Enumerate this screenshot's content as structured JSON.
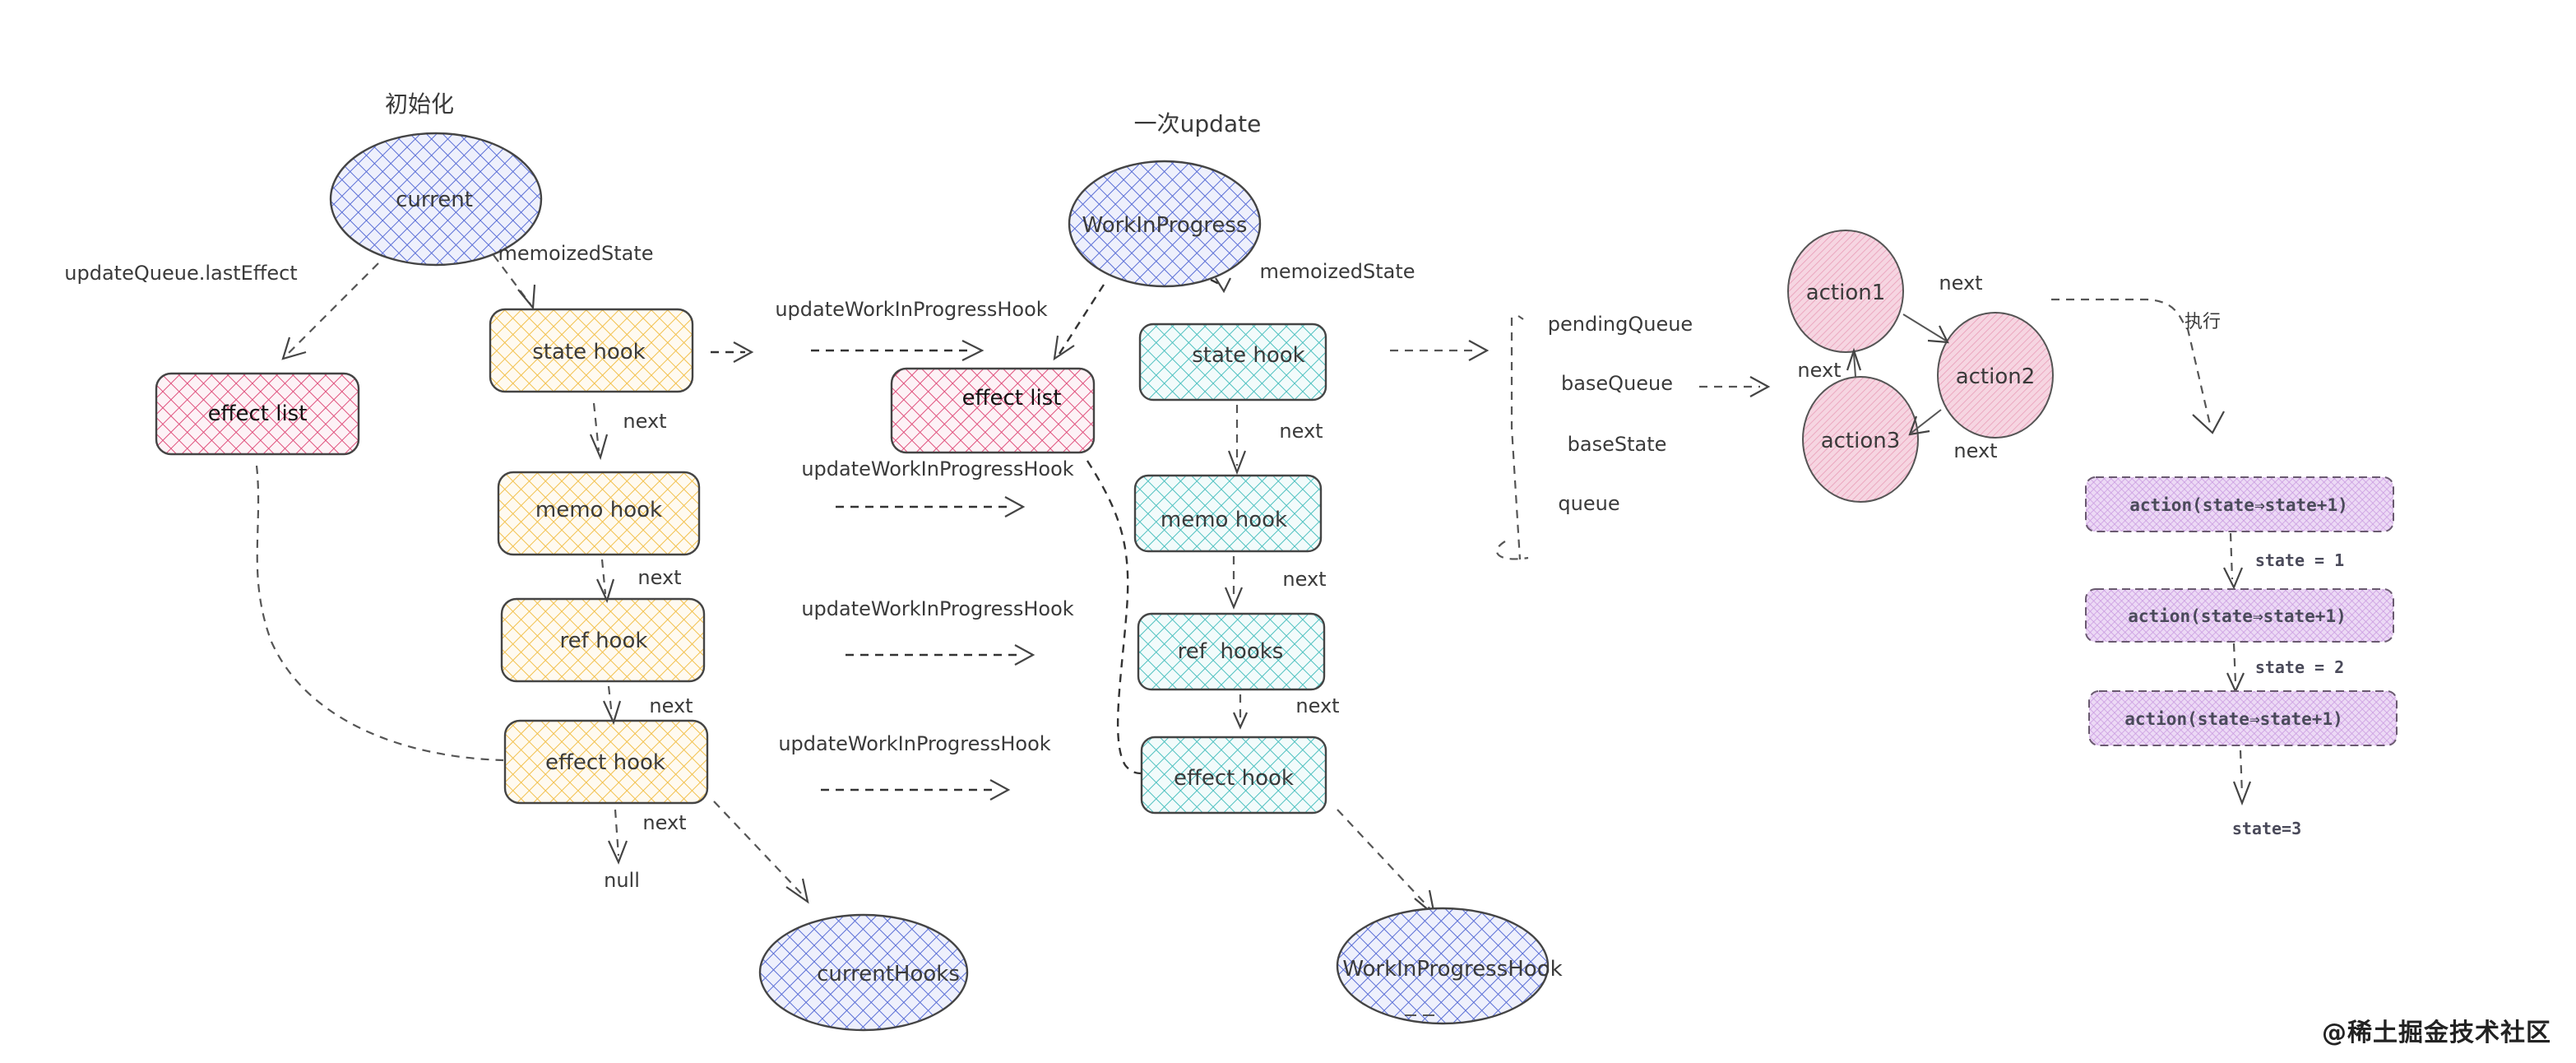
{
  "sections": {
    "init_title": "初始化",
    "update_title": "一次update"
  },
  "colors": {
    "yellow_hatch": "#f2c14e",
    "teal_hatch": "#4fc1c0",
    "pink_hatch": "#e0527e",
    "blue_hatch": "#5b6fd6",
    "action_pink": "#e89ab5",
    "action_purple": "#c99ae0",
    "stroke": "#444444"
  },
  "init": {
    "root": "current",
    "root_edge_state": "memoizedState",
    "root_edge_effect": "updateQueue.lastEffect",
    "effect_list": "effect list",
    "hooks": [
      "state hook",
      "memo hook",
      "ref hook",
      "effect hook"
    ],
    "next_label": "next",
    "terminator": "null",
    "pointer": "currentHooks"
  },
  "update": {
    "root": "WorkInProgress",
    "root_edge_state": "memoizedState",
    "effect_list": "effect list",
    "hooks": [
      "state hook",
      "memo hook",
      "ref  hooks",
      "effect hook"
    ],
    "next_label": "next",
    "pointer": "WorkInProgressHook",
    "transfer_label": "updateWorkInProgressHook"
  },
  "hook_fields": [
    "pendingQueue",
    "baseQueue",
    "baseState",
    "queue"
  ],
  "actions": {
    "nodes": [
      "action1",
      "action2",
      "action3"
    ],
    "next_label": "next",
    "execute_label": "执行",
    "steps": [
      "action(state⇒state+1)",
      "action(state⇒state+1)",
      "action(state⇒state+1)"
    ],
    "results": [
      "state = 1",
      "state = 2",
      "state=3"
    ]
  },
  "watermark": "@稀土掘金技术社区"
}
